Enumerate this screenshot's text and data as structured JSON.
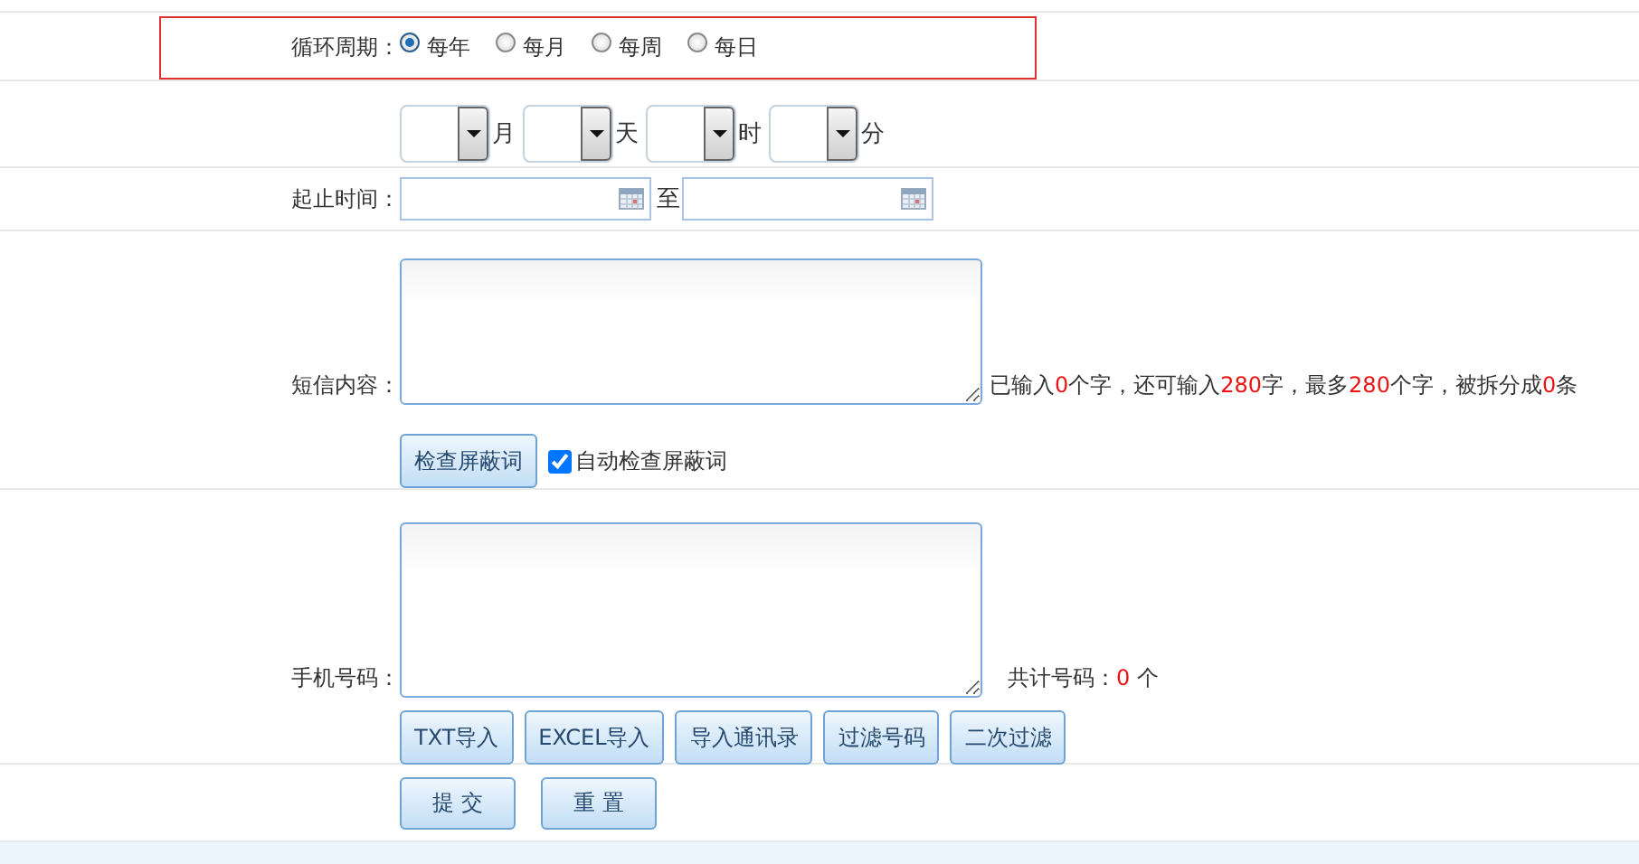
{
  "cycle": {
    "label": "循环周期：",
    "options": [
      {
        "label": "每年",
        "selected": true
      },
      {
        "label": "每月",
        "selected": false
      },
      {
        "label": "每周",
        "selected": false
      },
      {
        "label": "每日",
        "selected": false
      }
    ]
  },
  "time_selects": [
    {
      "unit": "月"
    },
    {
      "unit": "天"
    },
    {
      "unit": "时"
    },
    {
      "unit": "分"
    }
  ],
  "period": {
    "label": "起止时间：",
    "separator": "至"
  },
  "sms_content": {
    "label": "短信内容：",
    "count_note": [
      {
        "text": "已输入",
        "highlight": false
      },
      {
        "text": "0",
        "highlight": true
      },
      {
        "text": "个字，还可输入",
        "highlight": false
      },
      {
        "text": "280",
        "highlight": true
      },
      {
        "text": "字，最多",
        "highlight": false
      },
      {
        "text": "280",
        "highlight": true
      },
      {
        "text": "个字，被拆分成",
        "highlight": false
      },
      {
        "text": "0",
        "highlight": true
      },
      {
        "text": "条",
        "highlight": false
      }
    ],
    "check_button": "检查屏蔽词",
    "auto_check": {
      "label": "自动检查屏蔽词",
      "checked": true
    }
  },
  "phone_numbers": {
    "label": "手机号码：",
    "total_note": [
      {
        "text": "共计号码：",
        "highlight": false
      },
      {
        "text": "0",
        "highlight": true
      },
      {
        "text": " 个",
        "highlight": false
      }
    ],
    "buttons": [
      "TXT导入",
      "EXCEL导入",
      "导入通讯录",
      "过滤号码",
      "二次过滤"
    ]
  },
  "actions": [
    "提 交",
    "重 置"
  ]
}
